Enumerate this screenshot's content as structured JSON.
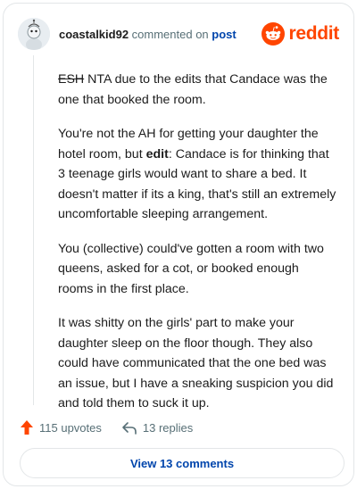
{
  "header": {
    "username": "coastalkid92",
    "action": "commented on",
    "target": "post",
    "brand": "reddit",
    "brand_color": "#ff4500"
  },
  "comment": {
    "p1_strike": "ESH",
    "p1_rest": " NTA due to the edits that Candace was the one that booked the room.",
    "p2_a": "You're not the AH for getting your daughter the hotel room, but ",
    "p2_bold": "edit",
    "p2_b": ": Candace is for thinking that 3 teenage girls would want to share a bed. It doesn't matter if its a king, that's still an extremely uncomfortable sleeping arrangement.",
    "p3": "You (collective) could've gotten a room with two queens, asked for a cot, or booked enough rooms in the first place.",
    "p4": "It was shitty on the girls' part to make your daughter sleep on the floor though. They also could have communicated that the one bed was an issue, but I have a sneaking suspicion you did and told them to suck it up."
  },
  "footer": {
    "upvotes": "115 upvotes",
    "replies": "13 replies",
    "view_button": "View 13 comments"
  },
  "icons": {
    "avatar": "avatar-icon",
    "logo": "reddit-snoo-icon",
    "upvote": "upvote-arrow-icon",
    "reply": "reply-arrow-icon"
  }
}
